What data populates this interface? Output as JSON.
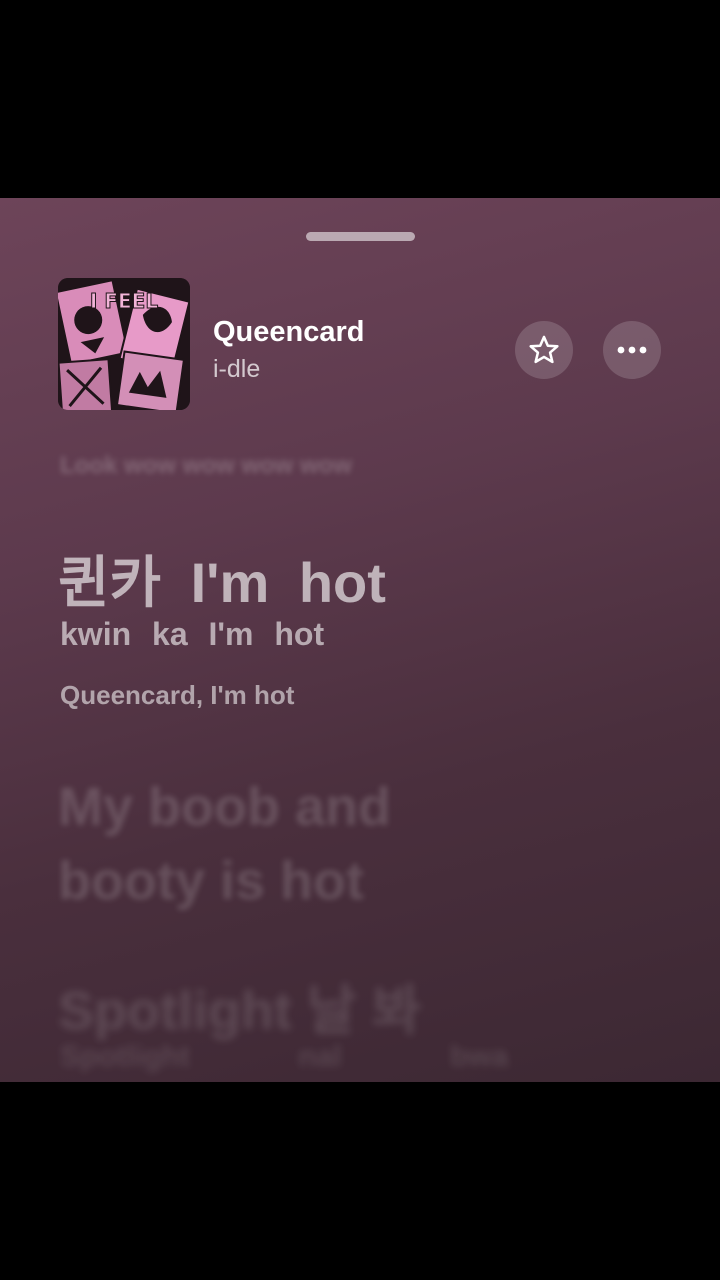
{
  "now_playing": {
    "title": "Queencard",
    "artist": "i-dle",
    "artwork_text": "I FEEL"
  },
  "actions": {
    "favorite_icon": "star-icon",
    "more_icon": "ellipsis-icon"
  },
  "lyrics": {
    "previous_line": "Look wow wow wow wow",
    "current": {
      "original": "퀸카 I'm hot",
      "romanization": "kwin ka I'm hot",
      "translation": "Queencard, I'm hot"
    },
    "next_line": "My boob and booty is hot",
    "following": {
      "original": "Spotlight 날 봐",
      "romanization": "Spotlight nal bwa"
    }
  },
  "colors": {
    "sheet_top": "#6d4459",
    "sheet_bottom": "#3c2833",
    "artwork_accent": "#e79ac8"
  }
}
